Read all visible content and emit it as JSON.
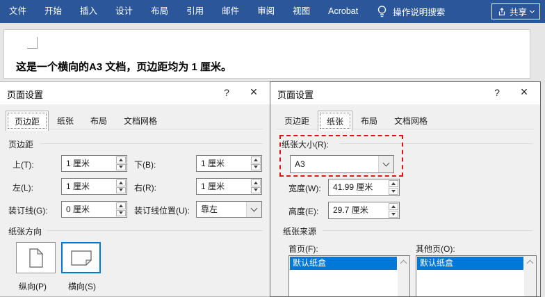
{
  "ribbon": {
    "tabs": [
      "文件",
      "开始",
      "插入",
      "设计",
      "布局",
      "引用",
      "邮件",
      "审阅",
      "视图",
      "Acrobat"
    ],
    "search_label": "操作说明搜索",
    "share_label": "共享"
  },
  "document": {
    "text": "这是一个横向的A3 文档，页边距均为 1 厘米。"
  },
  "dialog_left": {
    "title": "页面设置",
    "help_label": "?",
    "close_label": "×",
    "tabs": [
      "页边距",
      "纸张",
      "布局",
      "文档网格"
    ],
    "active_tab": "页边距",
    "group_margins": "页边距",
    "top_label": "上(T):",
    "top_value": "1 厘米",
    "bottom_label": "下(B):",
    "bottom_value": "1 厘米",
    "left_label": "左(L):",
    "left_value": "1 厘米",
    "right_label": "右(R):",
    "right_value": "1 厘米",
    "gutter_label": "装订线(G):",
    "gutter_value": "0 厘米",
    "gutter_pos_label": "装订线位置(U):",
    "gutter_pos_value": "靠左",
    "group_orientation": "纸张方向",
    "portrait_label": "纵向(P)",
    "landscape_label": "横向(S)",
    "selected_orientation": "横向(S)"
  },
  "dialog_right": {
    "title": "页面设置",
    "help_label": "?",
    "close_label": "×",
    "tabs": [
      "页边距",
      "纸张",
      "布局",
      "文档网格"
    ],
    "active_tab": "纸张",
    "paper_size_label": "纸张大小(R):",
    "paper_size_value": "A3",
    "width_label": "宽度(W):",
    "width_value": "41.99 厘米",
    "height_label": "高度(E):",
    "height_value": "29.7 厘米",
    "group_source": "纸张来源",
    "first_page_label": "首页(F):",
    "other_pages_label": "其他页(O):",
    "first_page_items": [
      "默认纸盒"
    ],
    "other_pages_items": [
      "默认纸盒"
    ]
  },
  "colors": {
    "ribbon_blue": "#2b579a",
    "selection_blue": "#0078d7",
    "annotation_red": "#e01212",
    "dialog_bg": "#f0f0f0"
  }
}
